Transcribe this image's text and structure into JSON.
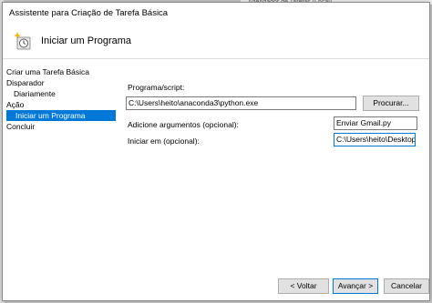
{
  "background": {
    "window_title": "Agendador de Tarefas (Local)"
  },
  "window": {
    "title": "Assistente para Criação de Tarefa Básica"
  },
  "header": {
    "title": "Iniciar um Programa",
    "icon": "clock-sparkle-icon"
  },
  "nav": {
    "items": [
      {
        "label": "Criar uma Tarefa Básica",
        "level": 0,
        "selected": false
      },
      {
        "label": "Disparador",
        "level": 0,
        "selected": false
      },
      {
        "label": "Diariamente",
        "level": 1,
        "selected": false
      },
      {
        "label": "Ação",
        "level": 0,
        "selected": false
      },
      {
        "label": "Iniciar um Programa",
        "level": 1,
        "selected": true
      },
      {
        "label": "Concluir",
        "level": 0,
        "selected": false
      }
    ]
  },
  "form": {
    "program_label": "Programa/script:",
    "program_value": "C:\\Users\\heito\\anaconda3\\python.exe",
    "browse_label": "Procurar...",
    "args_label": "Adicione argumentos (opcional):",
    "args_value": "Enviar Gmail.py",
    "start_in_label": "Iniciar em (opcional):",
    "start_in_value": "C:\\Users\\heito\\Desktop"
  },
  "footer": {
    "back_label": "< Voltar",
    "next_label": "Avançar >",
    "cancel_label": "Cancelar"
  },
  "colors": {
    "accent": "#0078d7",
    "button_bg": "#e1e1e1"
  }
}
